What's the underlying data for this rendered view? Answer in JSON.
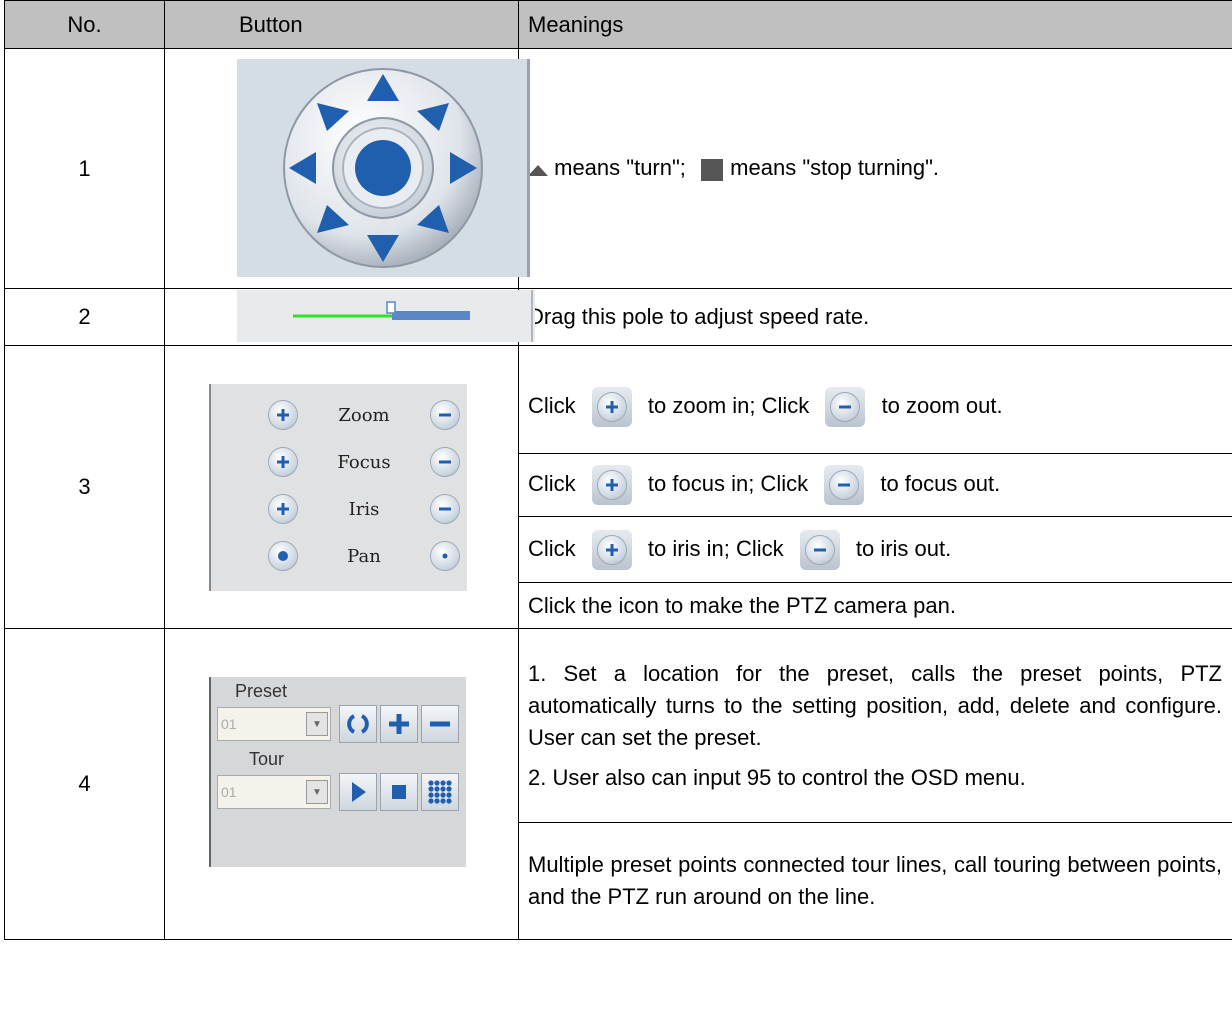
{
  "header": {
    "no": "No.",
    "button": "Button",
    "meanings": "Meanings"
  },
  "rows": {
    "r1": {
      "no": "1",
      "meaning_a": "means \"turn\";",
      "meaning_b": "means \"stop turning\"."
    },
    "r2": {
      "no": "2",
      "meaning": "Drag this pole to adjust speed rate."
    },
    "r3": {
      "no": "3",
      "ptz_labels": {
        "zoom": "Zoom",
        "focus": "Focus",
        "iris": "Iris",
        "pan": "Pan"
      },
      "m_zoom": {
        "click1": "Click",
        "mid": "to zoom in; Click",
        "end": "to zoom out."
      },
      "m_focus": {
        "click1": "Click",
        "mid": "to focus in; Click",
        "end": "to focus out."
      },
      "m_iris": {
        "click1": "Click",
        "mid": "to iris in; Click",
        "end": "to iris out."
      },
      "m_pan": "Click the icon to make the PTZ camera pan."
    },
    "r4": {
      "no": "4",
      "preset_label": "Preset",
      "preset_value": "01",
      "tour_label": "Tour",
      "tour_value": "01",
      "m1": "1. Set a location for the preset, calls the preset points, PTZ automatically turns to the setting position, add, delete and configure. User can set the preset.",
      "m2": "2. User also can input 95 to control the OSD menu.",
      "m3": "Multiple preset points connected tour lines, call touring between points, and the PTZ run around on the line."
    }
  },
  "colors": {
    "header_bg": "#c0c0c0",
    "arrow_blue": "#1f5fae",
    "slider_green": "#2ee02e",
    "slider_blue": "#5b87c6"
  }
}
